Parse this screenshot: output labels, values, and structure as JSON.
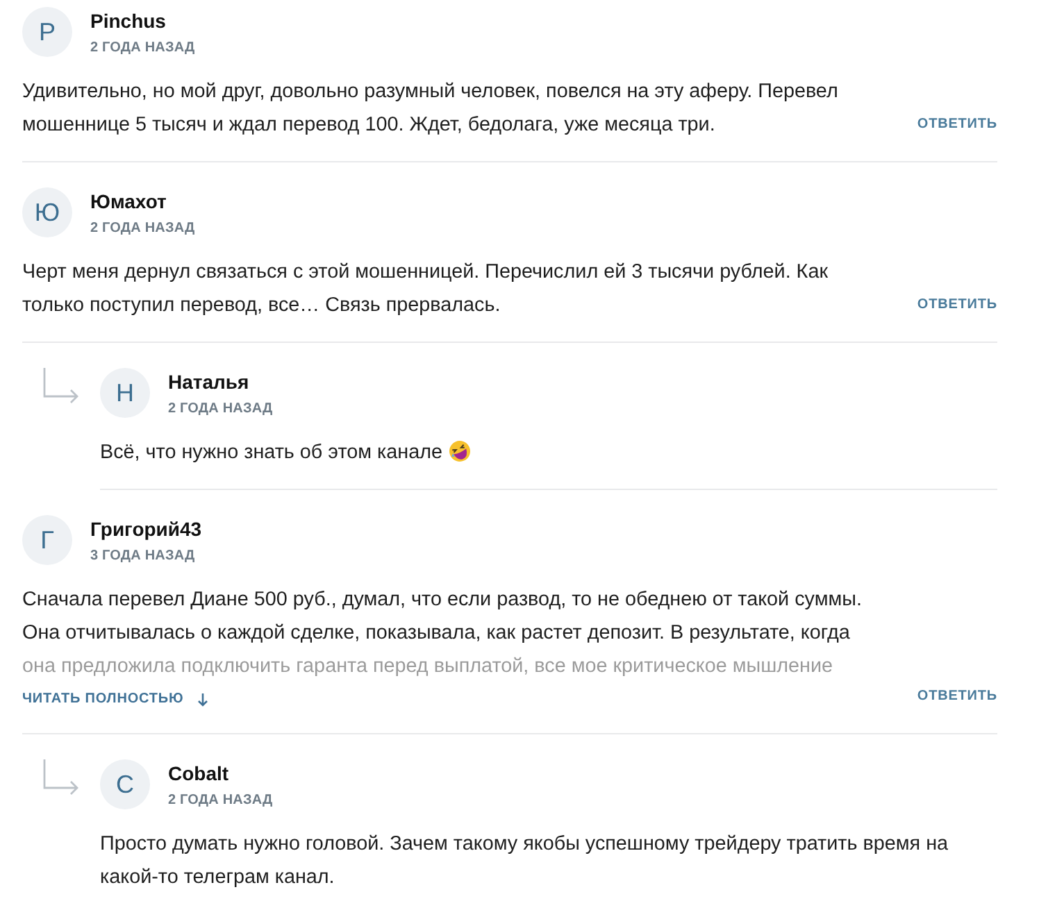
{
  "comments": [
    {
      "author": "Pinchus",
      "avatar_letter": "P",
      "time": "2 ГОДА НАЗАД",
      "text": "Удивительно, но мой друг, довольно разумный человек, повелся на эту аферу. Перевел мошеннице 5 тысяч и ждал перевод 100. Ждет, бедолага, уже месяца три.",
      "reply_label": "ОТВЕТИТЬ"
    },
    {
      "author": "Юмахот",
      "avatar_letter": "Ю",
      "time": "2 ГОДА НАЗАД",
      "text": "Черт меня дернул связаться с этой мошенницей. Перечислил ей 3 тысячи рублей. Как только поступил перевод, все… Связь прервалась.",
      "reply_label": "ОТВЕТИТЬ",
      "children": [
        {
          "author": "Наталья",
          "avatar_letter": "Н",
          "time": "2 ГОДА НАЗАД",
          "text": "Всё, что нужно знать об этом канале",
          "emoji": true
        }
      ]
    },
    {
      "author": "Григорий43",
      "avatar_letter": "Г",
      "time": "3 ГОДА НАЗАД",
      "text": "Сначала перевел Диане 500 руб., думал, что если развод, то не обеднею от такой суммы. Она отчитывалась о каждой сделке, показывала, как растет депозит. В результате, когда она предложила подключить гаранта перед выплатой, все мое критическое мышление",
      "collapsed": true,
      "read_more": "ЧИТАТЬ ПОЛНОСТЬЮ",
      "reply_label": "ОТВЕТИТЬ",
      "children": [
        {
          "author": "Cobalt",
          "avatar_letter": "C",
          "time": "2 ГОДА НАЗАД",
          "text": "Просто думать нужно головой. Зачем такому якобы успешному трейдеру тратить время на какой-то телеграм канал."
        }
      ]
    }
  ]
}
